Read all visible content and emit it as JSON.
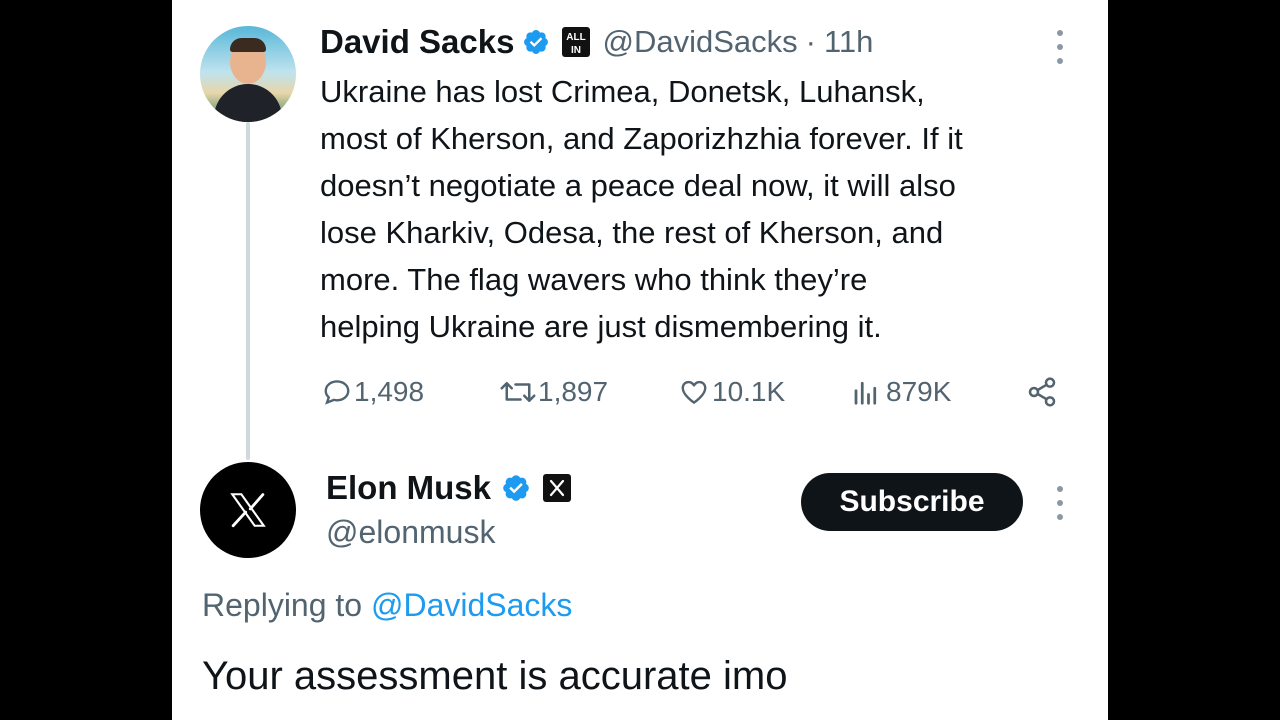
{
  "original_tweet": {
    "author_name": "David Sacks",
    "handle": "@DavidSacks",
    "separator": "·",
    "timestamp": "11h",
    "badge_text": "ALL IN",
    "text_lines": [
      "Ukraine has lost Crimea, Donetsk, Luhansk,",
      "most of Kherson, and Zaporizhzhia forever. If it",
      "doesn’t negotiate a peace deal now, it will also",
      "lose Kharkiv, Odesa, the rest of Kherson, and",
      "more. The flag wavers who think they’re",
      "helping Ukraine are just dismembering it."
    ],
    "stats": {
      "replies": "1,498",
      "reposts": "1,897",
      "likes": "10.1K",
      "views": "879K"
    }
  },
  "reply": {
    "author_name": "Elon Musk",
    "handle": "@elonmusk",
    "subscribe_label": "Subscribe",
    "replying_prefix": "Replying to",
    "replying_handle": "@DavidSacks",
    "text": "Your assessment is accurate imo"
  },
  "colors": {
    "verified_blue": "#1d9bf0",
    "text_primary": "#0f1419",
    "text_secondary": "#536471",
    "link": "#1d9bf0"
  },
  "icons": [
    "verified-badge-icon",
    "all-in-badge-icon",
    "x-logo-icon",
    "reply-icon",
    "repost-icon",
    "like-icon",
    "views-icon",
    "share-icon",
    "more-options-icon"
  ]
}
